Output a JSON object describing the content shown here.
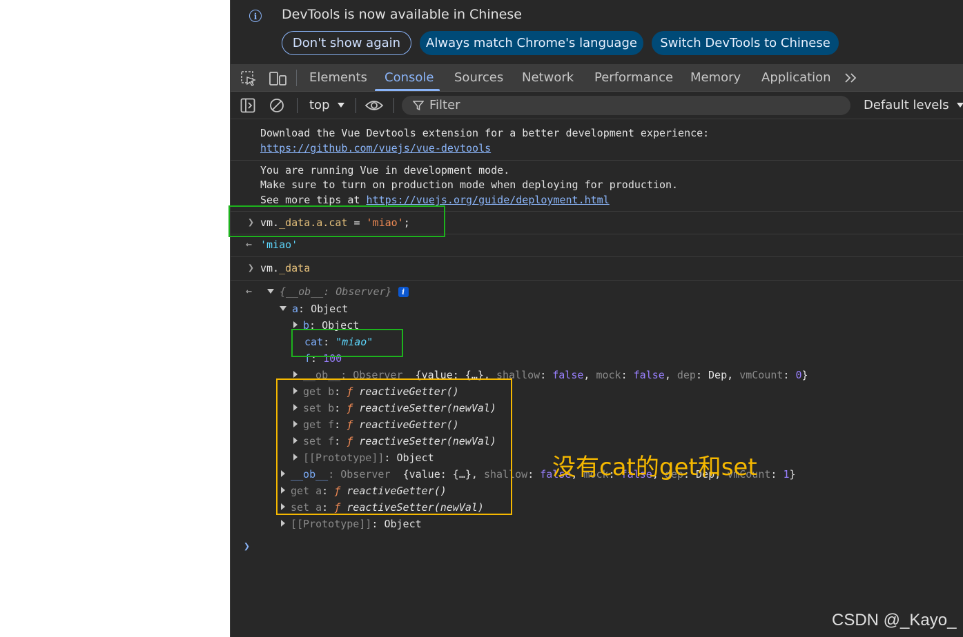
{
  "infobar": {
    "message": "DevTools is now available in Chinese",
    "buttons": [
      "Don't show again",
      "Always match Chrome's language",
      "Switch DevTools to Chinese"
    ]
  },
  "tabs": [
    "Elements",
    "Console",
    "Sources",
    "Network",
    "Performance",
    "Memory",
    "Application"
  ],
  "active_tab": "Console",
  "toolbar": {
    "context": "top",
    "filter_placeholder": "Filter",
    "levels": "Default levels"
  },
  "console": {
    "msg1_line1": "Download the Vue Devtools extension for a better development experience:",
    "msg1_link": "https://github.com/vuejs/vue-devtools",
    "msg2_line1": "You are running Vue in development mode.",
    "msg2_line2": "Make sure to turn on production mode when deploying for production.",
    "msg2_prefix": "See more tips at ",
    "msg2_link": "https://vuejs.org/guide/deployment.html",
    "cmd1_obj": "vm.",
    "cmd1_path": "_data.a.cat",
    "cmd1_op": " = ",
    "cmd1_val": "'miao'",
    "cmd1_end": ";",
    "result1": "'miao'",
    "cmd2_obj": "vm.",
    "cmd2_path": "_data",
    "obj_summary": "{__ob__: Observer}",
    "a_key": "a",
    "a_type": "Object",
    "b_key": "b",
    "b_type": "Object",
    "cat_key": "cat",
    "cat_val": "\"miao\"",
    "f_key": "f",
    "f_val": "100",
    "ob_key": "__ob__",
    "ob_type": "Observer",
    "ob_summary_open": "{value: {…}, ",
    "shallow_key": "shallow",
    "shallow_val": "false",
    "mock_key": "mock",
    "mock_val": "false",
    "dep_key": "dep",
    "dep_val": "Dep",
    "vmcount_key": "vmCount",
    "vmcount_val_inner": "0",
    "vmcount_val_outer": "1",
    "get_b": "get b",
    "set_b": "set b",
    "get_f": "get f",
    "set_f": "set f",
    "get_a": "get a",
    "set_a": "set a",
    "getter": "reactiveGetter()",
    "setter": "reactiveSetter(newVal)",
    "f_sym": "ƒ",
    "proto_key": "[[Prototype]]",
    "proto_type": "Object"
  },
  "annotation": "没有cat的get和set",
  "watermark": "CSDN @_Kayo_",
  "colors": {
    "green_box": "#1db31d",
    "yellow_box": "#f5b800",
    "accent": "#8ab4f8"
  }
}
